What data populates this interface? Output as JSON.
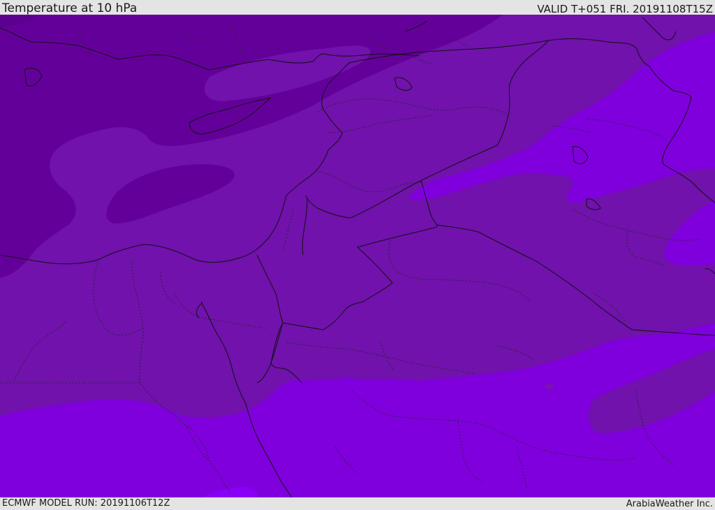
{
  "header": {
    "title": "Temperature at 10 hPa",
    "valid_time": "VALID T+051 FRI. 20191108T15Z"
  },
  "footer": {
    "model_run": "ECMWF MODEL RUN: 20191106T12Z",
    "credit": "ArabiaWeather Inc."
  },
  "colors": {
    "darkest": "#5c0090",
    "darker": "#64009a",
    "band_mid": "#7012ab",
    "band_light": "#7a10b8",
    "warm": "#7f00dc",
    "warmest": "#8a00f6",
    "borders": "#111111"
  },
  "map": {
    "variable": "temperature",
    "level": "10 hPa"
  }
}
